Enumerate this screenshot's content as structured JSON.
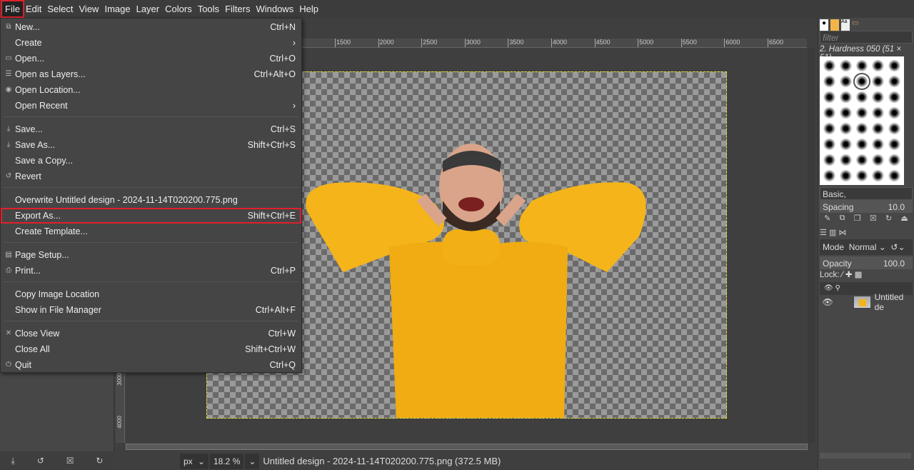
{
  "menubar": [
    "File",
    "Edit",
    "Select",
    "View",
    "Image",
    "Layer",
    "Colors",
    "Tools",
    "Filters",
    "Windows",
    "Help"
  ],
  "file_menu": [
    {
      "icon": "new-icon",
      "glyph": "⧉",
      "label": "New...",
      "shortcut": "Ctrl+N"
    },
    {
      "label": "Create",
      "shortcut": "›"
    },
    {
      "icon": "open-icon",
      "glyph": "▭",
      "label": "Open...",
      "shortcut": "Ctrl+O"
    },
    {
      "icon": "open-layers-icon",
      "glyph": "☰",
      "label": "Open as Layers...",
      "shortcut": "Ctrl+Alt+O"
    },
    {
      "icon": "globe-icon",
      "glyph": "◉",
      "label": "Open Location...",
      "shortcut": ""
    },
    {
      "label": "Open Recent",
      "shortcut": "›"
    },
    {
      "sep": true
    },
    {
      "icon": "save-icon",
      "glyph": "⤓",
      "label": "Save...",
      "shortcut": "Ctrl+S"
    },
    {
      "icon": "save-as-icon",
      "glyph": "⤓",
      "label": "Save As...",
      "shortcut": "Shift+Ctrl+S"
    },
    {
      "label": "Save a Copy...",
      "shortcut": ""
    },
    {
      "icon": "revert-icon",
      "glyph": "↺",
      "label": "Revert",
      "shortcut": ""
    },
    {
      "sep": true
    },
    {
      "label": "Overwrite Untitled design - 2024-11-14T020200.775.png",
      "shortcut": ""
    },
    {
      "label": "Export As...",
      "shortcut": "Shift+Ctrl+E",
      "highlight": true
    },
    {
      "label": "Create Template...",
      "shortcut": ""
    },
    {
      "sep": true
    },
    {
      "icon": "page-setup-icon",
      "glyph": "▤",
      "label": "Page Setup...",
      "shortcut": ""
    },
    {
      "icon": "print-icon",
      "glyph": "⎙",
      "label": "Print...",
      "shortcut": "Ctrl+P"
    },
    {
      "sep": true
    },
    {
      "label": "Copy Image Location",
      "shortcut": ""
    },
    {
      "label": "Show in File Manager",
      "shortcut": "Ctrl+Alt+F"
    },
    {
      "sep": true
    },
    {
      "icon": "close-icon",
      "glyph": "✕",
      "label": "Close View",
      "shortcut": "Ctrl+W"
    },
    {
      "label": "Close All",
      "shortcut": "Shift+Ctrl+W"
    },
    {
      "icon": "quit-icon",
      "glyph": "⏻",
      "label": "Quit",
      "shortcut": "Ctrl+Q"
    }
  ],
  "ruler": [
    "1500",
    "2000",
    "2500",
    "3000",
    "3500",
    "4000",
    "4500",
    "5000",
    "5500",
    "6000",
    "6500"
  ],
  "vruler": [
    "3000",
    "4000"
  ],
  "status": {
    "unit": "px",
    "zoom": "18.2 %",
    "title": "Untitled design - 2024-11-14T020200.775.png (372.5 MB)"
  },
  "brushes": {
    "filter_placeholder": "filter",
    "selected": "2. Hardness 050 (51 × 51)",
    "tag": "Basic,",
    "spacing_label": "Spacing",
    "spacing_value": "10.0"
  },
  "layers": {
    "mode_label": "Mode",
    "mode_value": "Normal",
    "opacity_label": "Opacity",
    "opacity_value": "100.0",
    "lock_label": "Lock:",
    "layer_name": "Untitled de"
  },
  "colors": {
    "accent": "#e0202a",
    "sweater": "#f5b51a"
  }
}
